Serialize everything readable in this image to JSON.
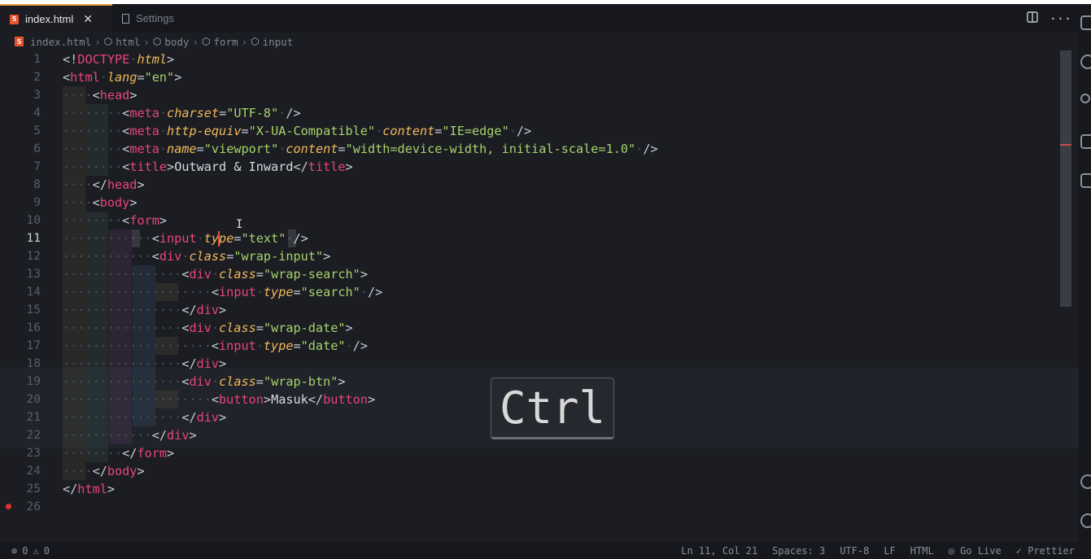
{
  "tabs": [
    {
      "label": "index.html",
      "icon": "html5-icon",
      "close": "✕",
      "active": true
    },
    {
      "label": "Settings",
      "icon": "file-icon",
      "active": false
    }
  ],
  "tab_actions": {
    "split": "split-editor-icon",
    "more": "···"
  },
  "breadcrumb": [
    "index.html",
    "html",
    "body",
    "form",
    "input"
  ],
  "editor": {
    "current_line": 11,
    "line_numbers": [
      "1",
      "2",
      "3",
      "4",
      "5",
      "6",
      "7",
      "8",
      "9",
      "10",
      "11",
      "12",
      "13",
      "14",
      "15",
      "16",
      "17",
      "18",
      "19",
      "20",
      "21",
      "22",
      "23",
      "24",
      "25",
      "26"
    ],
    "lines": [
      "<!DOCTYPE html>",
      "<html lang=\"en\">",
      "  <head>",
      "    <meta charset=\"UTF-8\" />",
      "    <meta http-equiv=\"X-UA-Compatible\" content=\"IE=edge\" />",
      "    <meta name=\"viewport\" content=\"width=device-width, initial-scale=1.0\" />",
      "    <title>Outward & Inward</title>",
      "  </head>",
      "  <body>",
      "    <form>",
      "      <input type=\"text\" />",
      "      <div class=\"wrap-input\">",
      "        <div class=\"wrap-search\">",
      "          <input type=\"search\" />",
      "        </div>",
      "        <div class=\"wrap-date\">",
      "          <input type=\"date\" />",
      "        </div>",
      "        <div class=\"wrap-btn\">",
      "          <button>Masuk</button>",
      "        </div>",
      "      </div>",
      "    </form>",
      "  </body>",
      "</html>",
      ""
    ]
  },
  "key_overlay": "Ctrl",
  "status": {
    "errors": "0",
    "warnings": "0",
    "position": "Ln 11, Col 21",
    "spaces": "Spaces: 3",
    "encoding": "UTF-8",
    "eol": "LF",
    "language": "HTML",
    "go_live": "Go Live",
    "prettier": "Prettier"
  },
  "colors": {
    "tag": "#e8457a",
    "attribute": "#f2b957",
    "string": "#a6d26a",
    "background": "#1b1d23",
    "active_tab_border": "#e5a03c"
  }
}
